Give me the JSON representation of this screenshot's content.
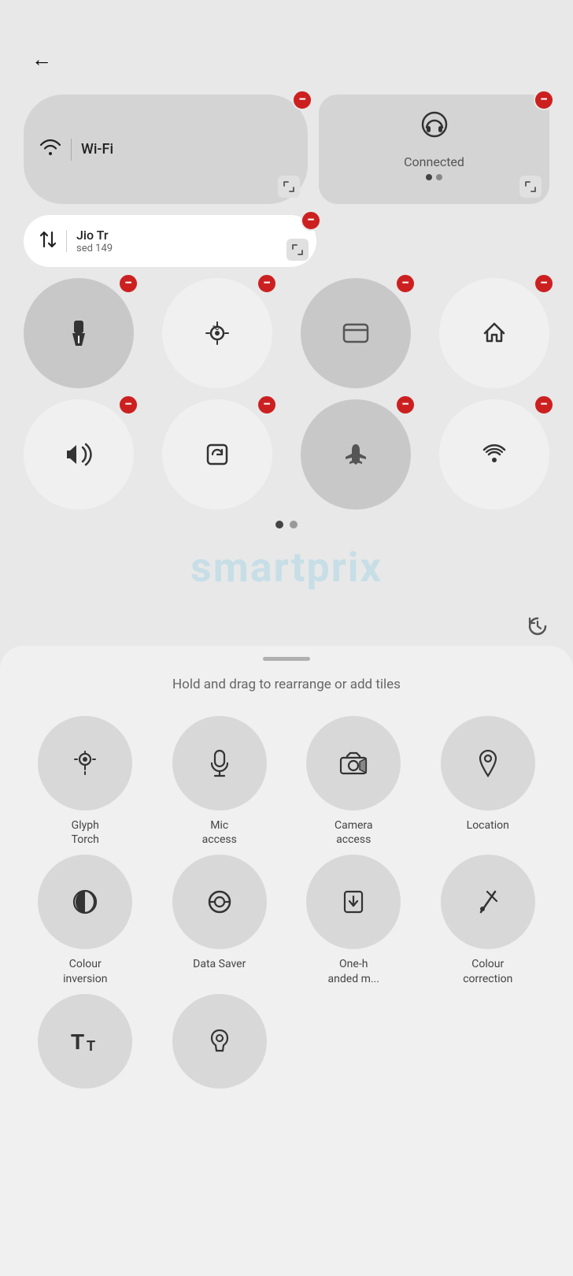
{
  "back_label": "←",
  "wifi": {
    "icon": "⬡",
    "label": "Wi-Fi"
  },
  "headset": {
    "label": "Connected"
  },
  "data": {
    "name": "Jio Tr",
    "usage": "sed   149"
  },
  "row3_tiles": [
    {
      "icon": "🔦",
      "type": "gray"
    },
    {
      "icon": "°C",
      "type": "white"
    },
    {
      "icon": "▬",
      "type": "gray"
    },
    {
      "icon": "🏠",
      "type": "white"
    }
  ],
  "row4_tiles": [
    {
      "icon": "🔊",
      "type": "white"
    },
    {
      "icon": "↺",
      "type": "white"
    },
    {
      "icon": "✈",
      "type": "gray"
    },
    {
      "icon": "📡",
      "type": "white"
    }
  ],
  "hint": "Hold and drag to rearrange or add tiles",
  "add_tiles": [
    {
      "icon": "☀",
      "label": "Glyph\nTorch",
      "icon_char": "☀"
    },
    {
      "icon": "🎤",
      "label": "Mic\naccess"
    },
    {
      "icon": "📹",
      "label": "Camera\naccess"
    },
    {
      "icon": "📍",
      "label": "Location"
    },
    {
      "icon": "◑",
      "label": "Colour\ninversion"
    },
    {
      "icon": "↻",
      "label": "Data Saver"
    },
    {
      "icon": "⬚",
      "label": "One-h\nanded m..."
    },
    {
      "icon": "✏",
      "label": "Colour\ncorrection"
    },
    {
      "icon": "T",
      "label": ""
    },
    {
      "icon": "👂",
      "label": ""
    }
  ],
  "watermark": "smartprix"
}
